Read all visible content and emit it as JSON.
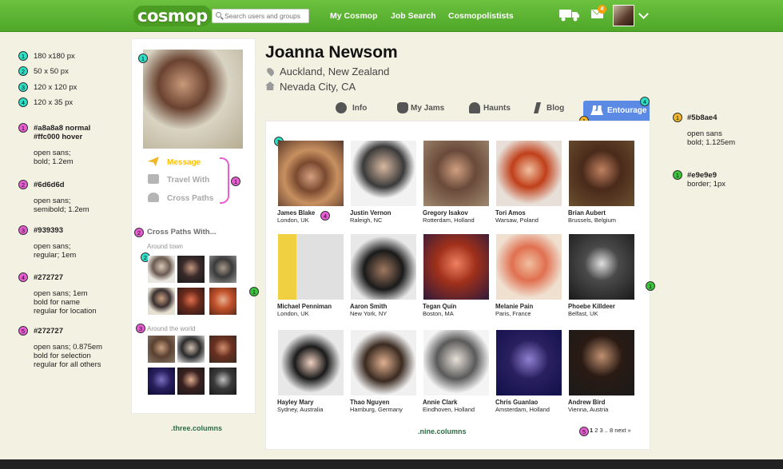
{
  "topbar": {
    "logo": "cosmop",
    "search_placeholder": "Search users and groups",
    "nav": [
      "My Cosmop",
      "Job Search",
      "Cosmopolistists"
    ],
    "mail_count": "4"
  },
  "left_legend": [
    {
      "n": "1",
      "color": "c",
      "text": "180 x180 px"
    },
    {
      "n": "2",
      "color": "c",
      "text": "50 x 50 px"
    },
    {
      "n": "3",
      "color": "c",
      "text": "120 x 120 px"
    },
    {
      "n": "4",
      "color": "c",
      "text": "120 x 35 px"
    }
  ],
  "style_legend": [
    {
      "n": "1",
      "lines": [
        "#a8a8a8 normal",
        "#ffc000 hover",
        "",
        "open sans;",
        "bold; 1.2em"
      ]
    },
    {
      "n": "2",
      "lines": [
        "#6d6d6d",
        "",
        "open sans;",
        "semibold; 1.2em"
      ]
    },
    {
      "n": "3",
      "lines": [
        "#939393",
        "",
        "open sans;",
        "regular; 1em"
      ]
    },
    {
      "n": "4",
      "lines": [
        "#272727",
        "",
        "open sans; 1em",
        "bold for name",
        "regular for location"
      ]
    },
    {
      "n": "5",
      "lines": [
        "#272727",
        "",
        "open sans; 0.875em",
        "bold for selection",
        "regular for all others"
      ]
    }
  ],
  "right_legend": [
    {
      "n": "1",
      "color": "y",
      "lines": [
        "#5b8ae4",
        "",
        "open sans",
        "bold; 1.125em"
      ]
    },
    {
      "n": "1",
      "color": "g",
      "lines": [
        "#e9e9e9",
        "border; 1px"
      ]
    }
  ],
  "profile": {
    "name": "Joanna Newsom",
    "location1": "Auckland, New Zealand",
    "location2": "Nevada City, CA",
    "actions": [
      "Message",
      "Travel With",
      "Cross Paths"
    ],
    "cross_paths_title": "Cross Paths With...",
    "around_town": "Around town",
    "around_world": "Around the world"
  },
  "tabs": [
    "Info",
    "My Jams",
    "Haunts",
    "Blog",
    "Entourage"
  ],
  "entourage": [
    {
      "name": "James Blake",
      "loc": "London, UK"
    },
    {
      "name": "Justin Vernon",
      "loc": "Raleigh, NC"
    },
    {
      "name": "Gregory Isakov",
      "loc": "Rotterdam, Holland"
    },
    {
      "name": "Tori Amos",
      "loc": "Warsaw, Poland"
    },
    {
      "name": "Brian Aubert",
      "loc": "Brussels, Belgium"
    },
    {
      "name": "Michael Penniman",
      "loc": "London, UK"
    },
    {
      "name": "Aaron Smith",
      "loc": "New York, NY"
    },
    {
      "name": "Tegan Quin",
      "loc": "Boston, MA"
    },
    {
      "name": "Melanie Pain",
      "loc": "Paris, France"
    },
    {
      "name": "Phoebe Killdeer",
      "loc": "Belfast, UK"
    },
    {
      "name": "Hayley Mary",
      "loc": "Sydney, Australia"
    },
    {
      "name": "Thao Nguyen",
      "loc": "Hamburg, Germany"
    },
    {
      "name": "Annie Clark",
      "loc": "Eindhoven, Holland"
    },
    {
      "name": "Chris Guanlao",
      "loc": "Amsterdam, Holland"
    },
    {
      "name": "Andrew Bird",
      "loc": "Vienna, Austria"
    }
  ],
  "pager": {
    "current": "1",
    "others": "2 3 .. 8 next »"
  },
  "captions": {
    "left": ".three.columns",
    "main": ".nine.columns"
  },
  "colors": {
    "accent": "#5b8ae4",
    "hover": "#ffc000",
    "border": "#e9e9e9",
    "topbar": "#5ab42f"
  }
}
